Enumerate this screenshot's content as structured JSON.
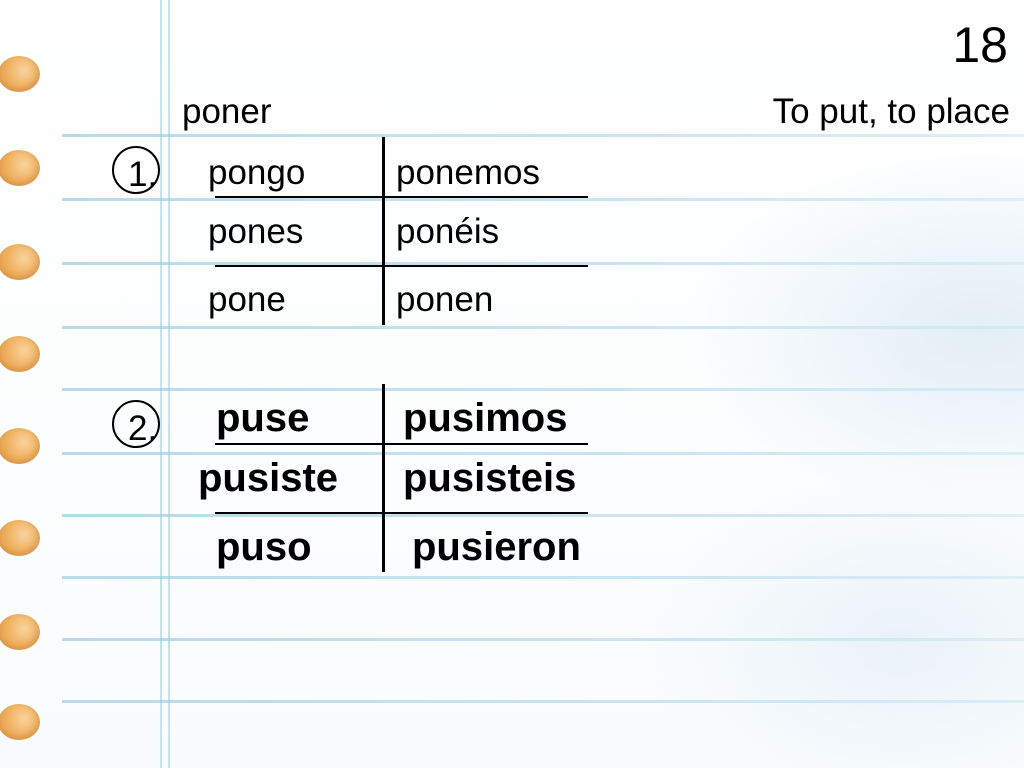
{
  "slide": {
    "page_number": "18",
    "verb": "poner",
    "translation": "To put, to place"
  },
  "section1": {
    "number": "1.",
    "rows": [
      {
        "left": "pongo",
        "right": "ponemos"
      },
      {
        "left": "pones",
        "right": "ponéis"
      },
      {
        "left": "pone",
        "right": "ponen"
      }
    ]
  },
  "section2": {
    "number": "2.",
    "rows": [
      {
        "left": "puse",
        "right": "pusimos"
      },
      {
        "left": "pusiste",
        "right": "pusisteis"
      },
      {
        "left": "puso",
        "right": "pusieron"
      }
    ]
  },
  "colors": {
    "ring_dot": "#eeae5c",
    "rule_line": "#afd7e8"
  }
}
